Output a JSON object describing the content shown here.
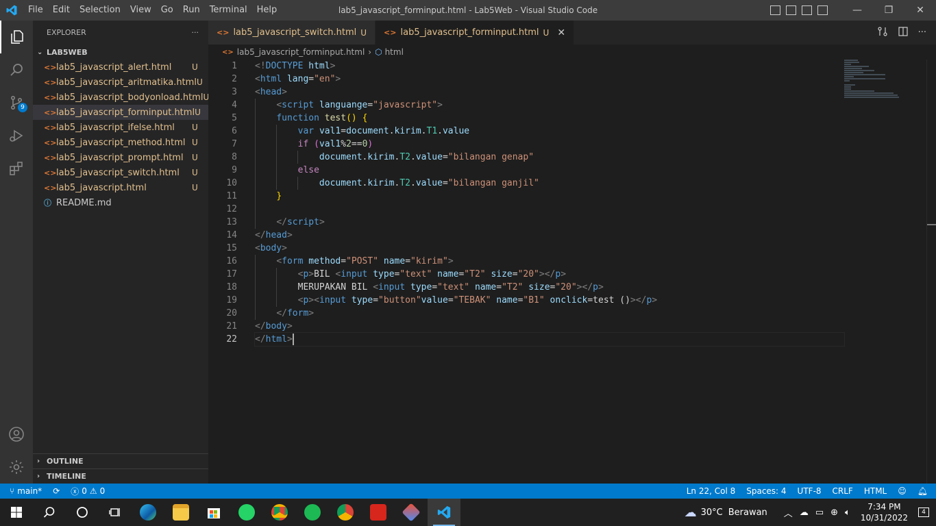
{
  "titlebar": {
    "menu": [
      "File",
      "Edit",
      "Selection",
      "View",
      "Go",
      "Run",
      "Terminal",
      "Help"
    ],
    "title": "lab5_javascript_forminput.html - Lab5Web - Visual Studio Code",
    "minimize": "—",
    "maximize": "❐",
    "close": "✕"
  },
  "activity": {
    "source_control_badge": "9"
  },
  "sidebar": {
    "header": "EXPLORER",
    "more": "···",
    "folder": "LAB5WEB",
    "files": [
      {
        "name": "lab5_javascript_alert.html",
        "status": "U"
      },
      {
        "name": "lab5_javascript_aritmatika.html",
        "status": "U"
      },
      {
        "name": "lab5_javascript_bodyonload.html",
        "status": "U"
      },
      {
        "name": "lab5_javascript_forminput.html",
        "status": "U"
      },
      {
        "name": "lab5_javascript_ifelse.html",
        "status": "U"
      },
      {
        "name": "lab5_javascript_method.html",
        "status": "U"
      },
      {
        "name": "lab5_javascript_prompt.html",
        "status": "U"
      },
      {
        "name": "lab5_javascript_switch.html",
        "status": "U"
      },
      {
        "name": "lab5_javascript.html",
        "status": "U"
      },
      {
        "name": "README.md",
        "status": ""
      }
    ],
    "outline": "OUTLINE",
    "timeline": "TIMELINE"
  },
  "tabs": [
    {
      "label": "lab5_javascript_switch.html",
      "status": "U"
    },
    {
      "label": "lab5_javascript_forminput.html",
      "status": "U",
      "close": "✕"
    }
  ],
  "breadcrumb": {
    "file": "lab5_javascript_forminput.html",
    "symbol": "html"
  },
  "editor": {
    "line_numbers": [
      "1",
      "2",
      "3",
      "4",
      "5",
      "6",
      "7",
      "8",
      "9",
      "10",
      "11",
      "12",
      "13",
      "14",
      "15",
      "16",
      "17",
      "18",
      "19",
      "20",
      "21",
      "22"
    ]
  },
  "statusbar": {
    "branch": "main*",
    "errors": "0",
    "warnings": "0",
    "position": "Ln 22, Col 8",
    "spaces": "Spaces: 4",
    "encoding": "UTF-8",
    "eol": "CRLF",
    "language": "HTML"
  },
  "taskbar": {
    "weather": "30°C",
    "weather_desc": "Berawan",
    "time": "7:34 PM",
    "date": "10/31/2022",
    "notifications": "4"
  },
  "colors": {
    "accent": "#007acc",
    "modified_file": "#e2c08d",
    "html_icon": "#e37933"
  }
}
